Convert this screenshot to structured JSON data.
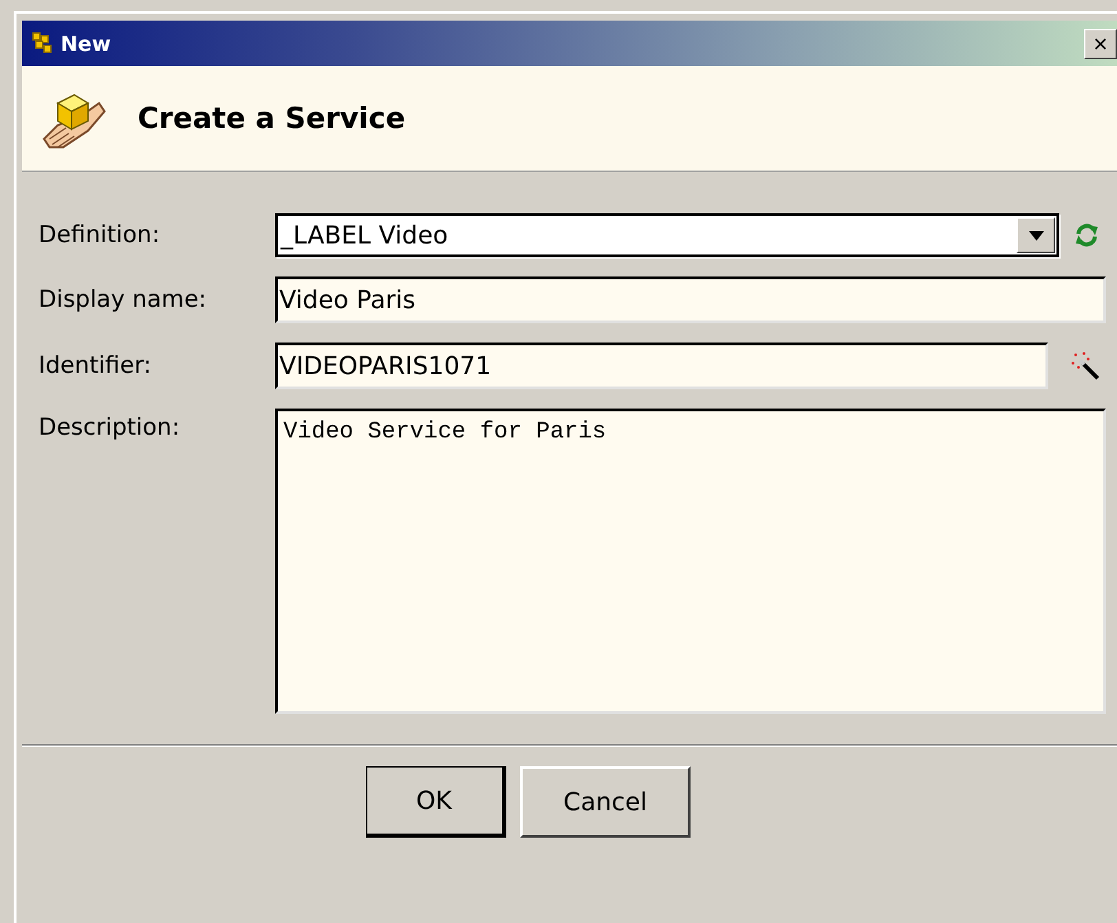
{
  "window": {
    "title": "New",
    "close": "×"
  },
  "header": {
    "title": "Create a Service"
  },
  "fields": [
    {
      "kind": "dropdown",
      "label": "Definition:",
      "value": "_LABEL Video"
    },
    {
      "kind": "text",
      "label": "Display name:",
      "value": "Video Paris"
    },
    {
      "kind": "text-wand",
      "label": "Identifier:",
      "value": "VIDEOPARIS1071"
    },
    {
      "kind": "textarea",
      "label": "Description:",
      "value": "Video Service for Paris"
    }
  ],
  "buttons": [
    {
      "label": "OK",
      "default": true
    },
    {
      "label": "Cancel",
      "default": false
    }
  ]
}
